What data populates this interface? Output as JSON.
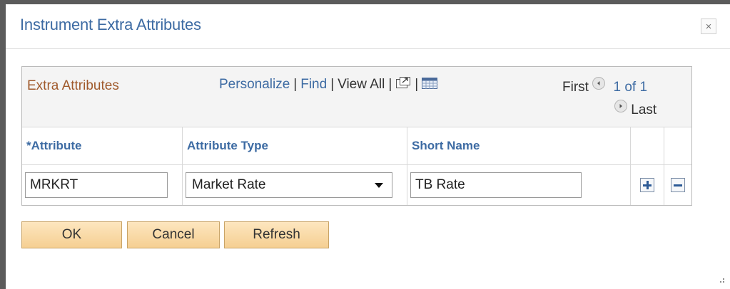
{
  "dialog": {
    "title": "Instrument Extra Attributes",
    "close_label": "×"
  },
  "grid": {
    "caption": "Extra Attributes",
    "nav": {
      "personalize": "Personalize",
      "find": "Find",
      "view_all": "View All",
      "sep": "|"
    },
    "pager": {
      "first": "First",
      "count": "1 of 1",
      "last": "Last"
    },
    "columns": {
      "attribute": "*Attribute",
      "attribute_type": "Attribute Type",
      "short_name": "Short Name"
    },
    "rows": [
      {
        "attribute": "MRKRT",
        "attribute_type": "Market Rate",
        "short_name": "TB Rate"
      }
    ],
    "icons": [
      "zoom-icon",
      "download-grid-icon",
      "previous-icon",
      "next-icon",
      "add-row-icon",
      "delete-row-icon",
      "dropdown-arrow-icon"
    ]
  },
  "buttons": {
    "ok": "OK",
    "cancel": "Cancel",
    "refresh": "Refresh"
  },
  "colors": {
    "title": "#3d6ba3",
    "link": "#3d6ba3",
    "caption": "#a05a2c",
    "button_bg": "#f5cf92"
  }
}
